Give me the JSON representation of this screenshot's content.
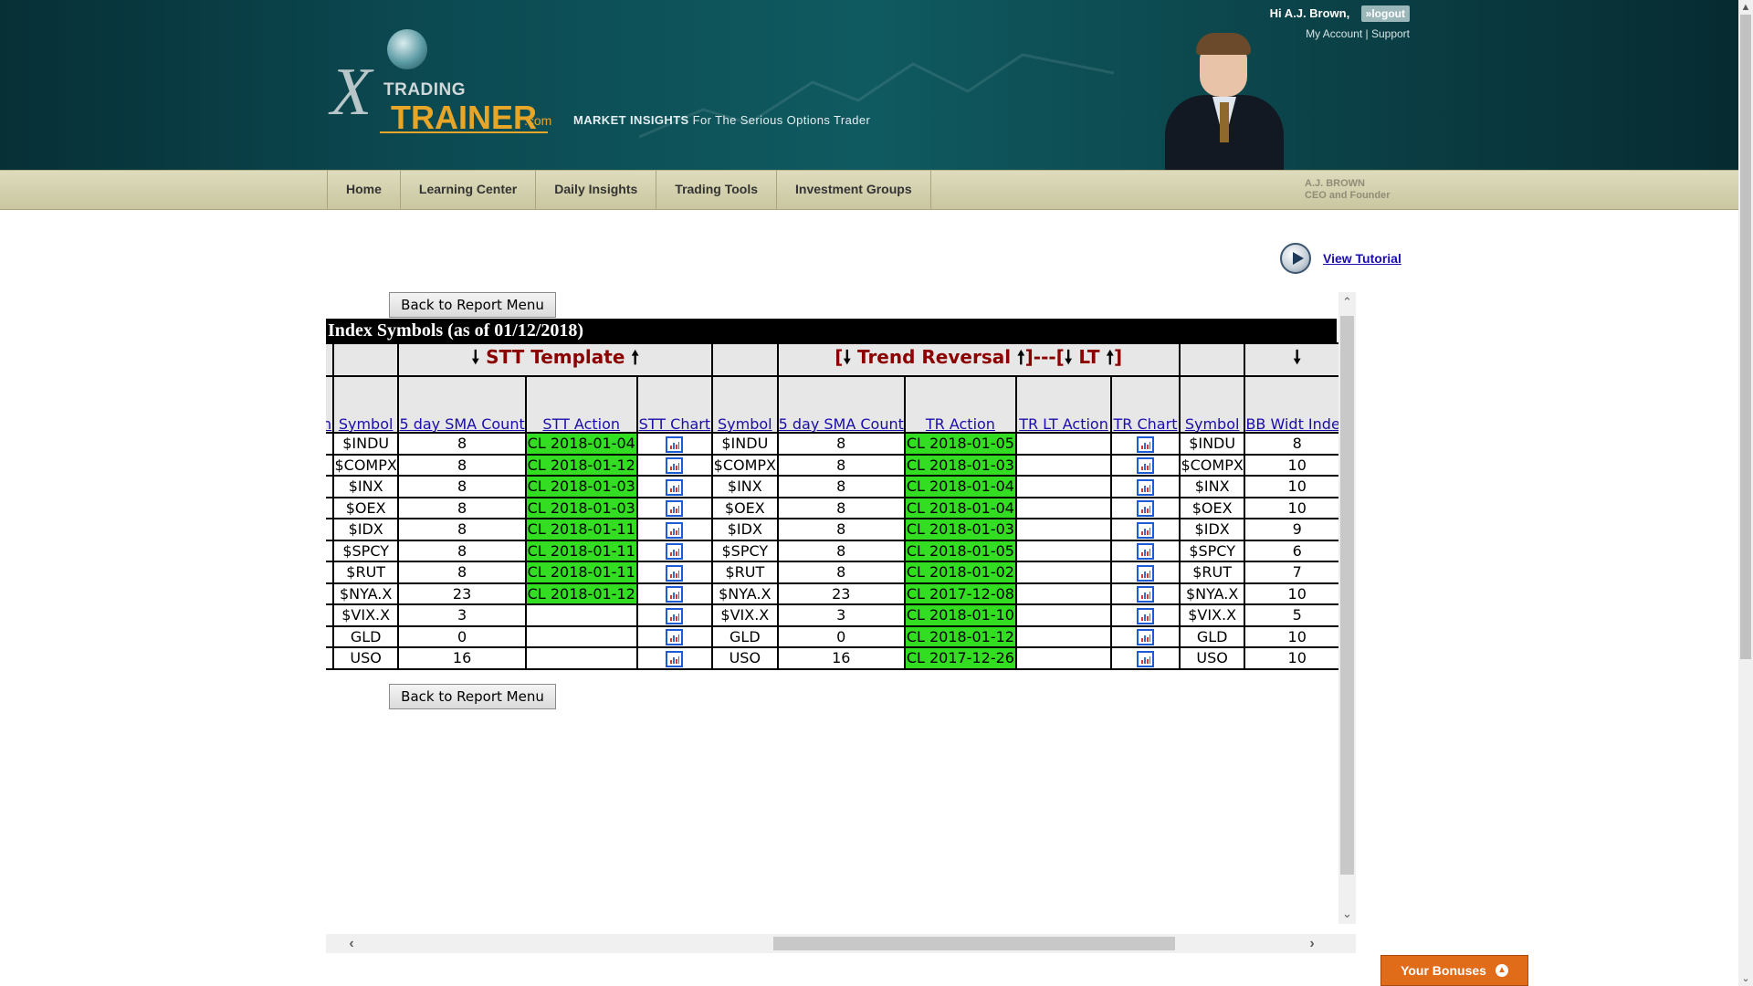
{
  "header": {
    "greeting": "Hi A.J. Brown,",
    "logout": "»logout",
    "my_account": "My Account",
    "separator": "|",
    "support": "Support",
    "logo_trading": "TRADING",
    "logo_trainer": "TRAINER",
    "logo_dotcom": ".com",
    "tagline_bold": "MARKET INSIGHTS",
    "tagline_rest": "For The Serious Options Trader",
    "ceo_name": "A.J. BROWN",
    "ceo_title": "CEO and Founder"
  },
  "nav": [
    "Home",
    "Learning Center",
    "Daily Insights",
    "Trading Tools",
    "Investment Groups"
  ],
  "tutorial_label": "View Tutorial",
  "back_button": "Back to Report Menu",
  "banner": "Index Symbols (as of 01/12/2018)",
  "group_headers": {
    "stt": "STT Template",
    "tr_left": "[",
    "tr": "Trend Reversal",
    "tr_mid": "]---[",
    "lt": "LT",
    "tr_right": "]"
  },
  "columns": {
    "cut": "n",
    "symbol": "Symbol",
    "sma_count": "5 day SMA Count",
    "stt_action": "STT Action",
    "stt_chart": "STT Chart",
    "tr_action": "TR Action",
    "tr_lt_action": "TR LT Action",
    "tr_chart": "TR Chart",
    "bb_width": "BB Widt Index"
  },
  "rows": [
    {
      "symbol": "$INDU",
      "stt_count": "8",
      "stt_action": "CL 2018-01-04",
      "tr_count": "8",
      "tr_action": "CL 2018-01-05",
      "tr_lt_action": "",
      "bb": "8"
    },
    {
      "symbol": "$COMPX",
      "stt_count": "8",
      "stt_action": "CL 2018-01-12",
      "tr_count": "8",
      "tr_action": "CL 2018-01-03",
      "tr_lt_action": "",
      "bb": "10"
    },
    {
      "symbol": "$INX",
      "stt_count": "8",
      "stt_action": "CL 2018-01-03",
      "tr_count": "8",
      "tr_action": "CL 2018-01-04",
      "tr_lt_action": "",
      "bb": "10"
    },
    {
      "symbol": "$OEX",
      "stt_count": "8",
      "stt_action": "CL 2018-01-03",
      "tr_count": "8",
      "tr_action": "CL 2018-01-04",
      "tr_lt_action": "",
      "bb": "10"
    },
    {
      "symbol": "$IDX",
      "stt_count": "8",
      "stt_action": "CL 2018-01-11",
      "tr_count": "8",
      "tr_action": "CL 2018-01-03",
      "tr_lt_action": "",
      "bb": "9"
    },
    {
      "symbol": "$SPCY",
      "stt_count": "8",
      "stt_action": "CL 2018-01-11",
      "tr_count": "8",
      "tr_action": "CL 2018-01-05",
      "tr_lt_action": "",
      "bb": "6"
    },
    {
      "symbol": "$RUT",
      "stt_count": "8",
      "stt_action": "CL 2018-01-11",
      "tr_count": "8",
      "tr_action": "CL 2018-01-02",
      "tr_lt_action": "",
      "bb": "7"
    },
    {
      "symbol": "$NYA.X",
      "stt_count": "23",
      "stt_action": "CL 2018-01-12",
      "tr_count": "23",
      "tr_action": "CL 2017-12-08",
      "tr_lt_action": "",
      "bb": "10"
    },
    {
      "symbol": "$VIX.X",
      "stt_count": "3",
      "stt_action": "",
      "tr_count": "3",
      "tr_action": "CL 2018-01-10",
      "tr_lt_action": "",
      "bb": "5"
    },
    {
      "symbol": "GLD",
      "stt_count": "0",
      "stt_action": "",
      "tr_count": "0",
      "tr_action": "CL 2018-01-12",
      "tr_lt_action": "",
      "bb": "10"
    },
    {
      "symbol": "USO",
      "stt_count": "16",
      "stt_action": "",
      "tr_count": "16",
      "tr_action": "CL 2017-12-26",
      "tr_lt_action": "",
      "bb": "10"
    }
  ],
  "bonuses_label": "Your Bonuses",
  "colors": {
    "header_bg": "#0c4a52",
    "nav_bg": "#d5d2b0",
    "action_green": "#33dd22",
    "group_header_red": "#8b0000",
    "link_blue": "#1a0dab",
    "bonus_orange": "#e06b18"
  },
  "icons": {
    "chart": "chart-icon",
    "play": "play-icon",
    "arrow_down": "arrow-down-icon",
    "arrow_up": "arrow-up-icon"
  }
}
